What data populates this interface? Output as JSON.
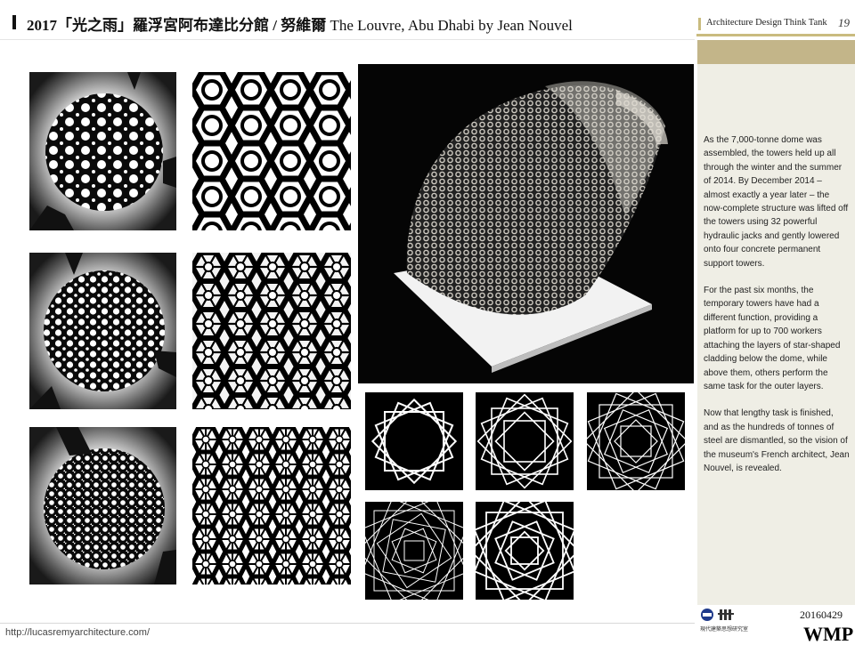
{
  "header": {
    "title_zh": "2017「光之雨」羅浮宮阿布達比分館 / 努維爾",
    "title_en": "The Louvre, Abu Dhabi by Jean Nouvel",
    "brand": "Architecture Design Think Tank",
    "page_number": "19"
  },
  "sidebar": {
    "paragraphs": [
      "As the 7,000-tonne dome was assembled, the towers held up all through the winter and the summer of 2014. By December 2014 – almost exactly a year later – the now-complete structure was lifted off the towers using 32 powerful hydraulic jacks and gently lowered onto four concrete permanent support towers.",
      "For the past six months, the temporary towers have had a different function, providing a platform for up to 700 workers attaching the layers of star-shaped cladding below the dome, while above them, others perform the same task for the outer layers.",
      "Now that lengthy task is finished, and as the hundreds of tonnes of steel are dismantled, so the vision of the museum's French architect, Jean Nouvel, is revealed."
    ]
  },
  "footer": {
    "url": "http://lucasremyarchitecture.com/",
    "date": "20160429",
    "org_cn": "現代建築思想研究室",
    "wmp": "WMP"
  },
  "theme": {
    "gold": "#c3b589",
    "panel": "#efeee5",
    "lattice": "#ffffff",
    "photo_bg": "#000000"
  },
  "icons": [
    "dome-lattice-photo",
    "lattice-closeup-photo",
    "dome-model-photo",
    "star-pattern-diagram",
    "university-logo-icon",
    "lab-logo-icon"
  ]
}
